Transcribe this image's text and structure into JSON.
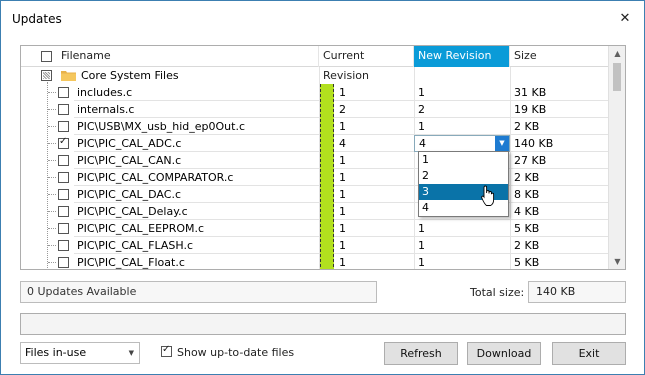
{
  "window": {
    "title": "Updates",
    "close_glyph": "✕"
  },
  "grid": {
    "columns": {
      "filename": "Filename",
      "current": "Current Revision",
      "new": "New Revision",
      "size": "Size"
    },
    "selected_column": "New Revision",
    "group": {
      "label": "Core System Files"
    },
    "rows": [
      {
        "name": "includes.c",
        "current": "1",
        "new": "1",
        "size": "31 KB",
        "checked": false
      },
      {
        "name": "internals.c",
        "current": "2",
        "new": "2",
        "size": "19 KB",
        "checked": false
      },
      {
        "name": "PIC\\USB\\MX_usb_hid_ep0Out.c",
        "current": "1",
        "new": "1",
        "size": "2 KB",
        "checked": false
      },
      {
        "name": "PIC\\PIC_CAL_ADC.c",
        "current": "4",
        "new": "4",
        "size": "140 KB",
        "checked": true
      },
      {
        "name": "PIC\\PIC_CAL_CAN.c",
        "current": "1",
        "new": "",
        "size": "27 KB",
        "checked": false
      },
      {
        "name": "PIC\\PIC_CAL_COMPARATOR.c",
        "current": "1",
        "new": "",
        "size": "2 KB",
        "checked": false
      },
      {
        "name": "PIC\\PIC_CAL_DAC.c",
        "current": "1",
        "new": "",
        "size": "8 KB",
        "checked": false
      },
      {
        "name": "PIC\\PIC_CAL_Delay.c",
        "current": "1",
        "new": "",
        "size": "4 KB",
        "checked": false
      },
      {
        "name": "PIC\\PIC_CAL_EEPROM.c",
        "current": "1",
        "new": "1",
        "size": "5 KB",
        "checked": false
      },
      {
        "name": "PIC\\PIC_CAL_FLASH.c",
        "current": "1",
        "new": "1",
        "size": "2 KB",
        "checked": false
      },
      {
        "name": "PIC\\PIC_CAL_Float.c",
        "current": "1",
        "new": "1",
        "size": "5 KB",
        "checked": false
      }
    ],
    "revision_dropdown": {
      "selected": "3",
      "options": [
        "1",
        "2",
        "3",
        "4"
      ]
    }
  },
  "status": {
    "updates_text": "0 Updates Available",
    "total_label": "Total size:",
    "total_value": "140 KB"
  },
  "footer": {
    "filter_select": "Files in-use",
    "show_uptodate_label": "Show up-to-date files",
    "show_uptodate_checked": true,
    "refresh_label": "Refresh",
    "download_label": "Download",
    "exit_label": "Exit"
  },
  "colors": {
    "accent": "#0a9bd8",
    "highlight": "#0a73a8",
    "revision_bar": "#b2e01e"
  },
  "icons": [
    "close-icon",
    "folder-icon",
    "checkbox-icon",
    "dropdown-arrow-icon",
    "mouse-cursor-icon",
    "scroll-up-icon",
    "scroll-down-icon"
  ]
}
